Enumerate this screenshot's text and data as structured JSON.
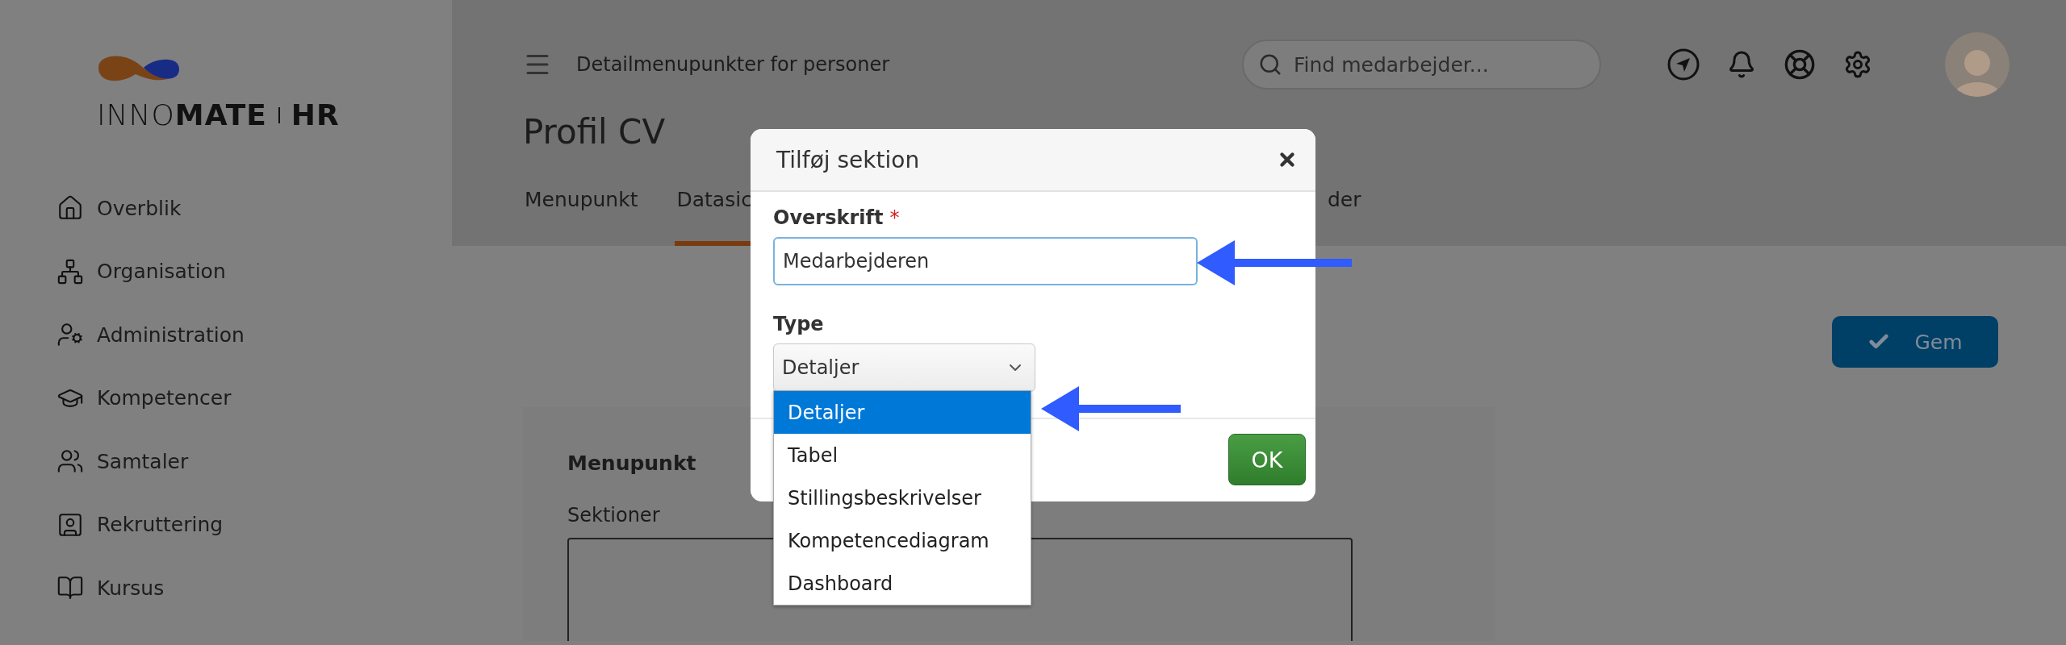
{
  "sidebar": {
    "logo": {
      "wordmark": "INNO**MATE**",
      "product": "HR"
    },
    "items": [
      {
        "label": "Overblik"
      },
      {
        "label": "Organisation"
      },
      {
        "label": "Administration"
      },
      {
        "label": "Kompetencer"
      },
      {
        "label": "Samtaler"
      },
      {
        "label": "Rekruttering"
      },
      {
        "label": "Kursus"
      }
    ]
  },
  "header": {
    "title": "Detailmenupunkter for personer",
    "search": {
      "placeholder": "Find medarbejder..."
    }
  },
  "page": {
    "title": "Profil CV",
    "tabs": [
      {
        "label": "Menupunkt",
        "selected": false
      },
      {
        "label": "Datasic",
        "selected": true
      },
      {
        "label": "der",
        "selected": false
      }
    ],
    "save_button": "Gem",
    "card": {
      "title": "Menupunkt",
      "sections_label": "Sektioner"
    }
  },
  "dialog": {
    "title": "Tilføj sektion",
    "heading_field": {
      "label": "Overskrift",
      "required_mark": "*",
      "value": "Medarbejderen"
    },
    "type_field": {
      "label": "Type",
      "value": "Detaljer",
      "options": [
        {
          "label": "Detaljer",
          "selected": true
        },
        {
          "label": "Tabel",
          "selected": false
        },
        {
          "label": "Stillingsbeskrivelser",
          "selected": false
        },
        {
          "label": "Kompetencediagram",
          "selected": false
        },
        {
          "label": "Dashboard",
          "selected": false
        }
      ]
    },
    "ok_button": "OK"
  }
}
